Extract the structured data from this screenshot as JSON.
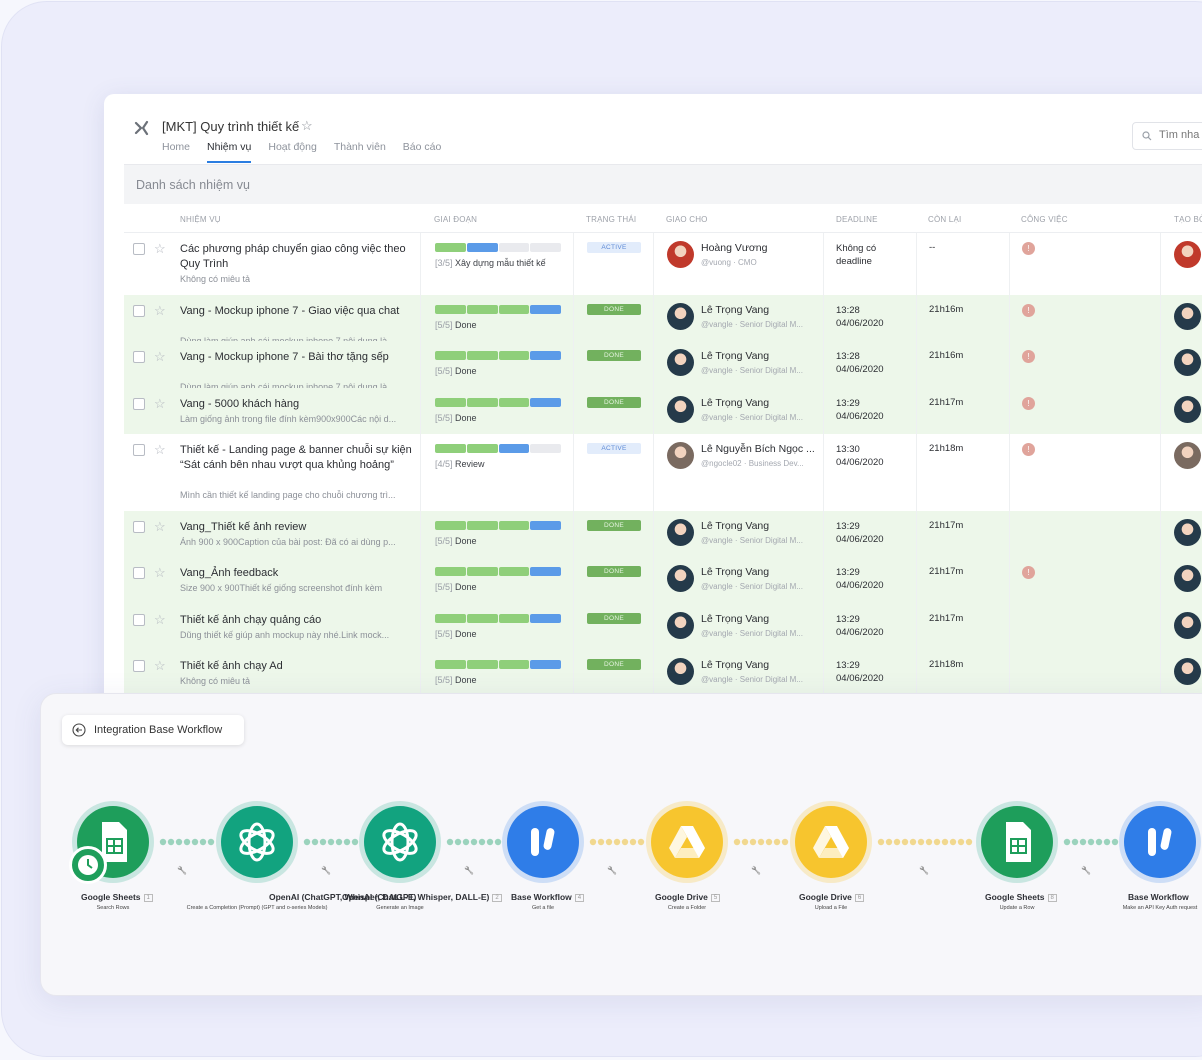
{
  "colors": {
    "done_green": "#72b15e",
    "progress_green": "#8fcf7a",
    "progress_blue": "#5b9be8",
    "row_done_bg": "#edf7ea",
    "tab_active": "#2a7de1"
  },
  "header": {
    "logo": "x-logo-icon",
    "title": "[MKT] Quy trình thiết kế",
    "star": "☆",
    "tabs": [
      "Home",
      "Nhiệm vụ",
      "Hoạt động",
      "Thành viên",
      "Báo cáo"
    ],
    "active_tab": "Nhiệm vụ",
    "search_placeholder": "Tìm nha"
  },
  "list_title": "Danh sách nhiệm vụ",
  "columns": [
    "NHIỆM VỤ",
    "GIAI ĐOẠN",
    "TRẠNG THÁI",
    "GIAO CHO",
    "DEADLINE",
    "CÒN LẠI",
    "CÔNG VIỆC",
    "TẠO BỞ"
  ],
  "rows": [
    {
      "title": "Các phương pháp chuyển giao công việc theo Quy Trình",
      "desc": "Không có miêu tả",
      "progress": "[3/5]",
      "stage": "Xây dựng mẫu thiết kế",
      "segments": [
        2,
        1,
        0,
        0
      ],
      "status": "ACTIVE",
      "assignee": "Hoàng Vương",
      "handle": "@vuong · CMO",
      "deadline": [
        "Không có",
        "deadline"
      ],
      "remaining": "--",
      "warn": true
    },
    {
      "title": "Vang - Mockup iphone 7 - Giao việc qua chat",
      "desc": "Dùng làm giúp anh cái mockup iphone 7 nội dung là...",
      "progress": "[5/5]",
      "stage": "Done",
      "segments": [
        2,
        2,
        2,
        1
      ],
      "status": "DONE",
      "assignee": "Lê Trọng Vang",
      "handle": "@vangle · Senior Digital M...",
      "deadline": [
        "13:28",
        "04/06/2020"
      ],
      "remaining": "21h16m",
      "warn": true
    },
    {
      "title": "Vang - Mockup iphone 7 - Bài thơ tặng sếp",
      "desc": "Dùng làm giúp anh cái mockup iphone 7 nội dung là...",
      "progress": "[5/5]",
      "stage": "Done",
      "segments": [
        2,
        2,
        2,
        1
      ],
      "status": "DONE",
      "assignee": "Lê Trọng Vang",
      "handle": "@vangle · Senior Digital M...",
      "deadline": [
        "13:28",
        "04/06/2020"
      ],
      "remaining": "21h16m",
      "warn": true
    },
    {
      "title": "Vang - 5000 khách hàng",
      "desc": "Làm giống ảnh trong file đính kèm900x900Các nội d...",
      "progress": "[5/5]",
      "stage": "Done",
      "segments": [
        2,
        2,
        2,
        1
      ],
      "status": "DONE",
      "assignee": "Lê Trọng Vang",
      "handle": "@vangle · Senior Digital M...",
      "deadline": [
        "13:29",
        "04/06/2020"
      ],
      "remaining": "21h17m",
      "warn": true
    },
    {
      "title": "Thiết kế - Landing page & banner chuỗi sự kiện “Sát cánh bên nhau vượt qua khủng hoảng”",
      "desc": "Mình cần thiết kế landing page cho chuỗi chương trì...",
      "progress": "[4/5]",
      "stage": "Review",
      "segments": [
        2,
        2,
        1,
        0
      ],
      "status": "ACTIVE",
      "assignee": "Lê Nguyễn Bích Ngọc ...",
      "handle": "@ngocle02 · Business Dev...",
      "deadline": [
        "13:30",
        "04/06/2020"
      ],
      "remaining": "21h18m",
      "warn": true
    },
    {
      "title": "Vang_Thiết kế ảnh review",
      "desc": "Ảnh 900 x 900Caption của bài post: Đã có ai dùng p...",
      "progress": "[5/5]",
      "stage": "Done",
      "segments": [
        2,
        2,
        2,
        1
      ],
      "status": "DONE",
      "assignee": "Lê Trọng Vang",
      "handle": "@vangle · Senior Digital M...",
      "deadline": [
        "13:29",
        "04/06/2020"
      ],
      "remaining": "21h17m",
      "warn": false
    },
    {
      "title": "Vang_Ảnh feedback",
      "desc": "Size 900 x 900Thiết kế giống screenshot đính kèm",
      "progress": "[5/5]",
      "stage": "Done",
      "segments": [
        2,
        2,
        2,
        1
      ],
      "status": "DONE",
      "assignee": "Lê Trọng Vang",
      "handle": "@vangle · Senior Digital M...",
      "deadline": [
        "13:29",
        "04/06/2020"
      ],
      "remaining": "21h17m",
      "warn": true
    },
    {
      "title": "Thiết kế ảnh chạy quảng cáo",
      "desc": "Dũng thiết kế giúp anh mockup này nhé.Link mock...",
      "progress": "[5/5]",
      "stage": "Done",
      "segments": [
        2,
        2,
        2,
        1
      ],
      "status": "DONE",
      "assignee": "Lê Trọng Vang",
      "handle": "@vangle · Senior Digital M...",
      "deadline": [
        "13:29",
        "04/06/2020"
      ],
      "remaining": "21h17m",
      "warn": false
    },
    {
      "title": "Thiết kế ảnh chạy Ad",
      "desc": "Không có miêu tả",
      "progress": "[5/5]",
      "stage": "Done",
      "segments": [
        2,
        2,
        2,
        1
      ],
      "status": "DONE",
      "assignee": "Lê Trọng Vang",
      "handle": "@vangle · Senior Digital M...",
      "deadline": [
        "13:29",
        "04/06/2020"
      ],
      "remaining": "21h18m",
      "warn": false
    }
  ],
  "workflow": {
    "back_label": "Integration Base Workflow",
    "nodes": [
      {
        "app": "Google Sheets",
        "num": "1",
        "sub": "Search Rows",
        "icon": "google-sheets-icon"
      },
      {
        "app": "OpenAI (ChatGPT, Whisper, DALL-E)",
        "num": "",
        "sub": "Create a Completion (Prompt) (GPT and o-series Models)",
        "icon": "openai-icon"
      },
      {
        "app": "OpenAI (ChatGPT, Whisper, DALL-E)",
        "num": "2",
        "sub": "Generate an Image",
        "icon": "openai-icon"
      },
      {
        "app": "Base Workflow",
        "num": "4",
        "sub": "Get a file",
        "icon": "base-workflow-icon"
      },
      {
        "app": "Google Drive",
        "num": "5",
        "sub": "Create a Folder",
        "icon": "google-drive-icon"
      },
      {
        "app": "Google Drive",
        "num": "6",
        "sub": "Upload a File",
        "icon": "google-drive-icon"
      },
      {
        "app": "Google Sheets",
        "num": "8",
        "sub": "Update a Row",
        "icon": "google-sheets-icon"
      },
      {
        "app": "Base Workflow",
        "num": "",
        "sub": "Make an API Key Auth request",
        "icon": "base-workflow-icon"
      }
    ]
  }
}
